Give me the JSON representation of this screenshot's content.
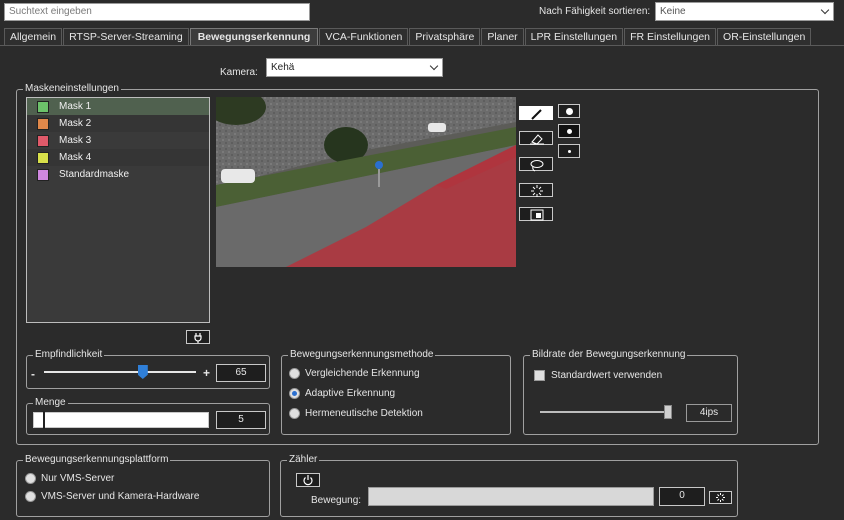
{
  "top": {
    "search_placeholder": "Suchtext eingeben",
    "sort_label": "Nach Fähigkeit sortieren:",
    "sort_value": "Keine"
  },
  "tabs": [
    {
      "label": "Allgemein"
    },
    {
      "label": "RTSP-Server-Streaming"
    },
    {
      "label": "Bewegungserkennung",
      "active": true
    },
    {
      "label": "VCA-Funktionen"
    },
    {
      "label": "Privatsphäre"
    },
    {
      "label": "Planer"
    },
    {
      "label": "LPR Einstellungen"
    },
    {
      "label": "FR Einstellungen"
    },
    {
      "label": "OR-Einstellungen"
    }
  ],
  "camera": {
    "label": "Kamera:",
    "value": "Kehä"
  },
  "mask_settings": {
    "title": "Maskeneinstellungen",
    "masks": [
      {
        "name": "Mask 1",
        "color": "#6cc26a",
        "selected": true
      },
      {
        "name": "Mask 2",
        "color": "#e0884a"
      },
      {
        "name": "Mask 3",
        "color": "#e05a6a"
      },
      {
        "name": "Mask 4",
        "color": "#d8e04a"
      },
      {
        "name": "Standardmaske",
        "color": "#d088e0"
      }
    ],
    "tools": [
      "pencil-icon",
      "eraser-icon",
      "lasso-icon",
      "clear-icon",
      "invert-icon"
    ],
    "brush_sizes": [
      "large",
      "medium",
      "small"
    ]
  },
  "sensitivity": {
    "title": "Empfindlichkeit",
    "minus": "-",
    "plus": "+",
    "value": "65",
    "level": 65
  },
  "amount": {
    "title": "Menge",
    "value": "5"
  },
  "method": {
    "title": "Bewegungserkennungsmethode",
    "options": [
      {
        "label": "Vergleichende Erkennung",
        "selected": false
      },
      {
        "label": "Adaptive Erkennung",
        "selected": true
      },
      {
        "label": "Hermeneutische Detektion",
        "selected": false
      }
    ]
  },
  "framerate": {
    "title": "Bildrate der Bewegungserkennung",
    "checkbox_label": "Standardwert verwenden",
    "value": "4ips"
  },
  "platform": {
    "title": "Bewegungserkennungsplattform",
    "options": [
      {
        "label": "Nur VMS-Server",
        "selected": false
      },
      {
        "label": "VMS-Server und Kamera-Hardware",
        "selected": false
      }
    ]
  },
  "counter": {
    "title": "Zähler",
    "movement_label": "Bewegung:",
    "value": "0"
  },
  "colors": {
    "accent": "#2f7fd8",
    "mask_overlay": "#b4323c"
  }
}
